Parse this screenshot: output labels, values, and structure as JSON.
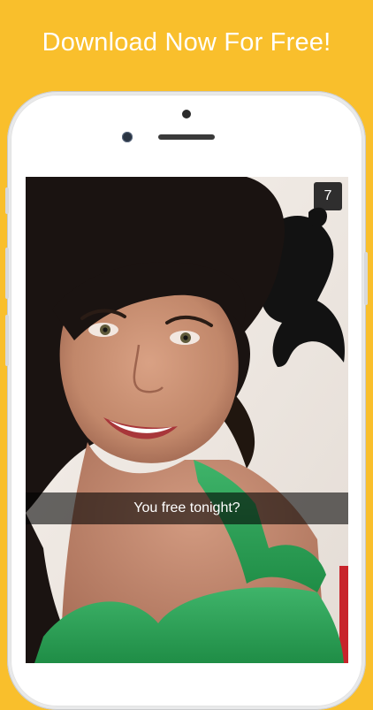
{
  "header": {
    "title": "Download Now For Free!"
  },
  "snap": {
    "timer_seconds": "7",
    "caption": "You free tonight?"
  },
  "colors": {
    "background": "#F9BF2C",
    "phone_body": "#E8E9EA",
    "caption_bar": "#000000"
  }
}
